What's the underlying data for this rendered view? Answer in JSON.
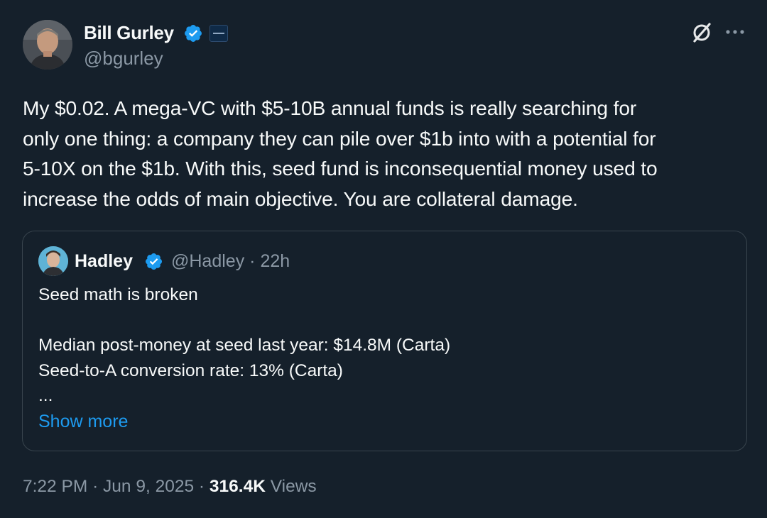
{
  "tweet": {
    "author": {
      "name": "Bill Gurley",
      "handle": "@bgurley",
      "verified": true
    },
    "text_lines": [
      "My $0.02.  A mega-VC with $5-10B annual funds is really searching for",
      "only one thing: a company they can pile over $1b into with a potential for",
      "5-10X on the $1b. With this, seed fund is inconsequential money used to",
      "increase the odds of main objective. You are collateral damage."
    ],
    "quote": {
      "author_name": "Hadley",
      "handle": "@Hadley",
      "separator": "·",
      "time": "22h",
      "lines": [
        "Seed math is broken",
        "",
        "Median post-money at seed last year: $14.8M (Carta)",
        "Seed-to-A conversion rate: 13% (Carta)",
        "..."
      ],
      "show_more_label": "Show more"
    },
    "footer": {
      "time": "7:22 PM",
      "sep1": "·",
      "date": "Jun 9, 2025",
      "sep2": "·",
      "views_count": "316.4K",
      "views_label": "Views"
    }
  },
  "icons": {
    "verified": "verified-badge-icon",
    "affiliate": "affiliate-badge-icon",
    "grok": "grok-icon",
    "more": "more-options-icon"
  },
  "colors": {
    "background": "#15202b",
    "text_primary": "#f7f9f9",
    "text_secondary": "#8b98a5",
    "accent": "#1d9bf0",
    "border": "#38444d"
  }
}
